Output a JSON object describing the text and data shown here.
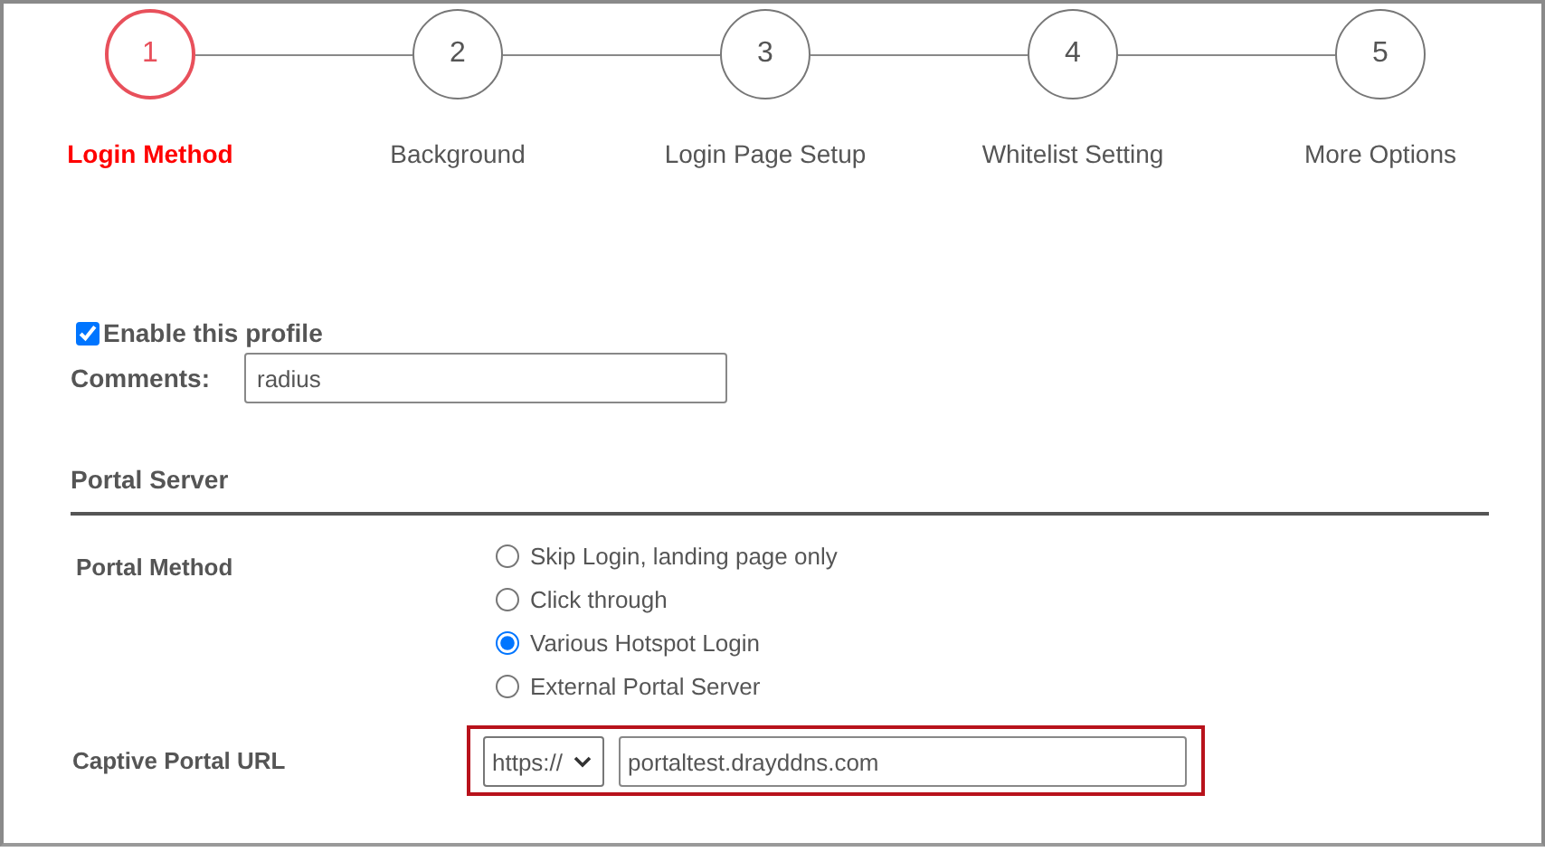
{
  "steps": [
    {
      "number": "1",
      "label": "Login Method",
      "selected": true
    },
    {
      "number": "2",
      "label": "Background",
      "selected": false
    },
    {
      "number": "3",
      "label": "Login Page Setup",
      "selected": false
    },
    {
      "number": "4",
      "label": "Whitelist Setting",
      "selected": false
    },
    {
      "number": "5",
      "label": "More Options",
      "selected": false
    }
  ],
  "enable_profile": {
    "label": "Enable this profile",
    "checked": true
  },
  "comments": {
    "label": "Comments:",
    "value": "radius"
  },
  "section_title": "Portal Server",
  "portal_method": {
    "label": "Portal Method",
    "options": [
      {
        "label": "Skip Login, landing page only",
        "selected": false
      },
      {
        "label": "Click through",
        "selected": false
      },
      {
        "label": "Various Hotspot Login",
        "selected": true
      },
      {
        "label": "External Portal Server",
        "selected": false
      }
    ]
  },
  "captive_portal_url": {
    "label": "Captive Portal URL",
    "protocol": "https://",
    "value": "portaltest.drayddns.com",
    "highlighted": true
  }
}
